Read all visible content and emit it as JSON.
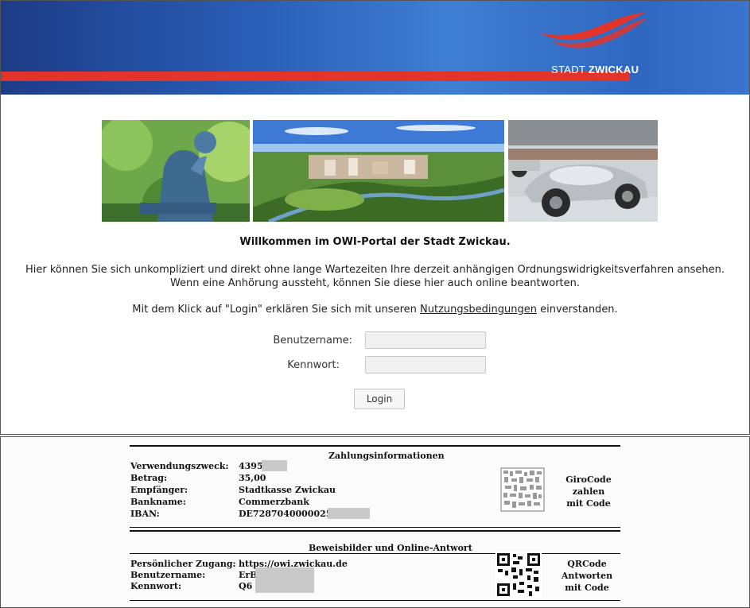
{
  "header": {
    "logo_text_light": "STADT ",
    "logo_text_bold": "ZWICKAU",
    "colors": {
      "banner_blue": "#2a5fb8",
      "accent_red": "#e3342b"
    }
  },
  "photos": [
    "statue-photo",
    "city-aerial-photo",
    "race-car-photo"
  ],
  "main": {
    "welcome": "Willkommen im OWI-Portal der Stadt Zwickau.",
    "intro_line1": "Hier können Sie sich unkompliziert und direkt ohne lange Wartezeiten Ihre derzeit anhängigen Ordnungswidrigkeitsverfahren ansehen.",
    "intro_line2": "Wenn eine Anhörung aussteht, können Sie diese hier auch online beantworten.",
    "terms_before": "Mit dem Klick auf \"Login\" erklären Sie sich mit unseren ",
    "terms_link": "Nutzungsbedingungen",
    "terms_after": " einverstanden."
  },
  "form": {
    "username_label": "Benutzername:",
    "username_value": "",
    "password_label": "Kennwort:",
    "password_value": "",
    "login_label": "Login"
  },
  "letter": {
    "payment": {
      "title": "Zahlungsinformationen",
      "rows": [
        {
          "key": "Verwendungszweck:",
          "value": "4395"
        },
        {
          "key": "Betrag:",
          "value": "35,00"
        },
        {
          "key": "Empfänger:",
          "value": "Stadtkasse Zwickau"
        },
        {
          "key": "Bankname:",
          "value": "Commerzbank"
        },
        {
          "key": "IBAN:",
          "value": "DE72870400000255"
        }
      ],
      "qr_caption": [
        "GiroCode",
        "zahlen",
        "mit Code"
      ]
    },
    "access": {
      "title": "Beweisbilder und Online-Antwort",
      "rows": [
        {
          "key": "Persönlicher Zugang:",
          "value": "https://owi.zwickau.de"
        },
        {
          "key": "Benutzername:",
          "value": "ErB"
        },
        {
          "key": "Kennwort:",
          "value": "Q6"
        }
      ],
      "qr_caption": [
        "QRCode",
        "Antworten",
        "mit Code"
      ]
    }
  }
}
